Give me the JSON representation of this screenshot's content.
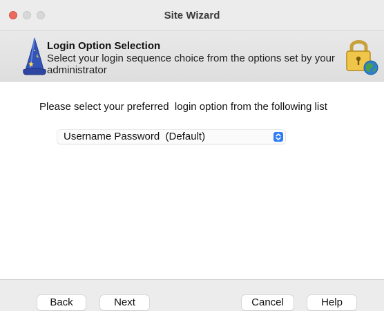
{
  "window": {
    "title": "Site Wizard",
    "traffic_lights": [
      "close",
      "minimize",
      "zoom"
    ]
  },
  "header": {
    "title": "Login Option Selection",
    "description": "Select your login sequence choice from the options set by your administrator",
    "left_icon": "wizard-hat-icon",
    "right_icon": "lock-globe-icon"
  },
  "content": {
    "prompt": "Please select your preferred  login option from the following list",
    "select": {
      "value": "Username Password  (Default)",
      "accent": "#2f7cf6"
    }
  },
  "footer": {
    "back_label": "Back",
    "next_label": "Next",
    "cancel_label": "Cancel",
    "help_label": "Help"
  }
}
